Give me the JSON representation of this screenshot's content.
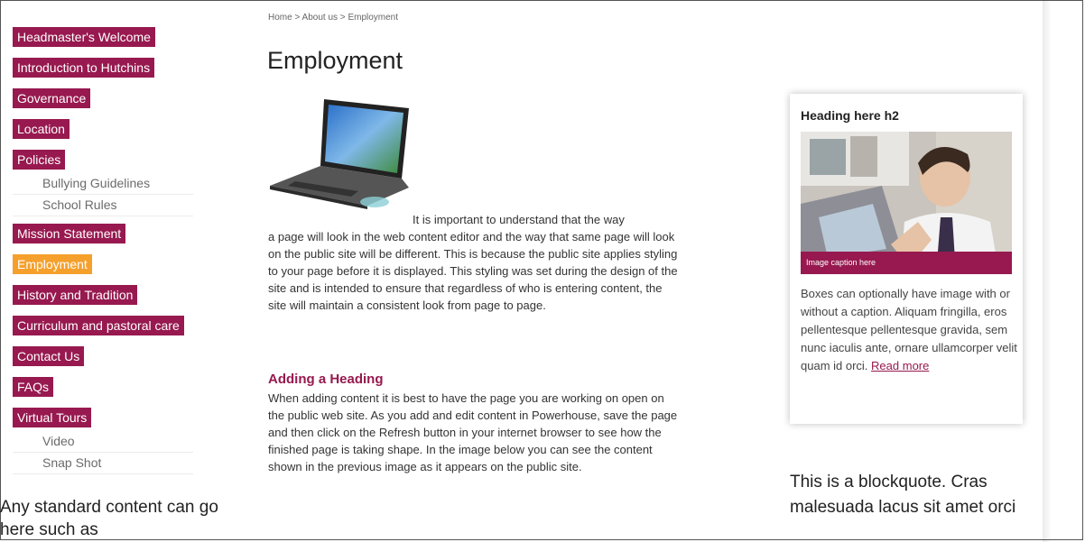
{
  "colors": {
    "nav_bg": "#97194f",
    "nav_active": "#f5a02c",
    "heading": "#97194f"
  },
  "breadcrumb": {
    "home": "Home",
    "sep": " > ",
    "about": "About us",
    "current": "Employment"
  },
  "nav": {
    "items": [
      {
        "label": "Headmaster's Welcome"
      },
      {
        "label": "Introduction to Hutchins"
      },
      {
        "label": "Governance"
      },
      {
        "label": "Location"
      },
      {
        "label": "Policies"
      },
      {
        "label": "Mission Statement"
      },
      {
        "label": "Employment"
      },
      {
        "label": "History and Tradition"
      },
      {
        "label": "Curriculum and pastoral care"
      },
      {
        "label": "Contact Us"
      },
      {
        "label": "FAQs"
      },
      {
        "label": "Virtual Tours"
      }
    ],
    "policies_sub": [
      "Bullying Guidelines",
      "School Rules"
    ],
    "tours_sub": [
      "Video",
      "Snap Shot"
    ]
  },
  "sidebar_text": "Any standard content can go here such as",
  "main": {
    "title": "Employment",
    "p1_first": "It is important to understand that the way",
    "p1_rest": "a page will look in the web content editor and the way that same page will look on the public site will be different. This is because the public site applies styling to your page before it is displayed. This styling was set during the design of the site and is intended to ensure that regardless of who is entering content, the site will maintain a consistent look from page to page.",
    "heading2": "Adding a Heading",
    "p2": "When adding content it is best to have the page you are working on open on the public web site. As you add and edit content in Powerhouse, save the page and then click on the Refresh button in your internet browser to see how the finished page is taking shape. In the image below you can see the content shown in the previous image as it appears on the public site."
  },
  "box": {
    "title": "Heading here h2",
    "caption": "Image caption here",
    "text": "Boxes can optionally have image with or without a caption. Aliquam fringilla, eros pellentesque pellentesque gravida, sem nunc iaculis ante, ornare ullamcorper velit quam id orci.",
    "read_more": "Read more"
  },
  "blockquote": "This is a blockquote. Cras malesuada lacus sit amet orci"
}
